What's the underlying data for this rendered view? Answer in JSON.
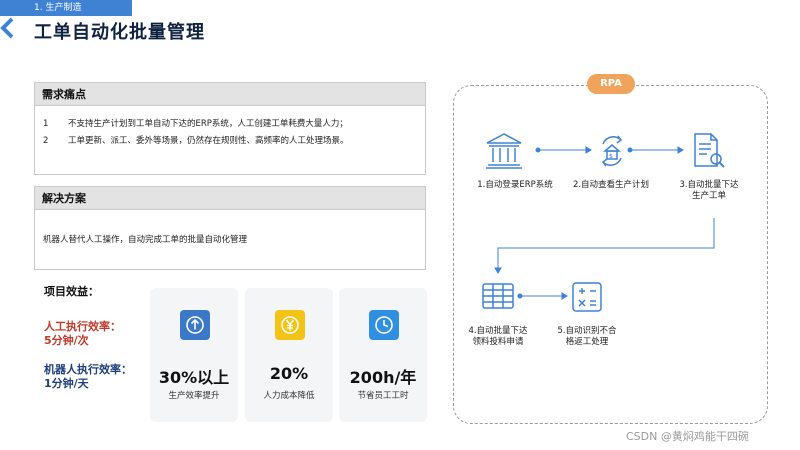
{
  "header": {
    "section_tag": "1. 生产制造",
    "title": "工单自动化批量管理"
  },
  "pain_points": {
    "title": "需求痛点",
    "items": [
      {
        "num": "1",
        "text": "不支持生产计划到工单自动下达的ERP系统，人工创建工单耗费大量人力；"
      },
      {
        "num": "2",
        "text": "工单更新、派工、委外等场景，仍然存在规则性、高频率的人工处理场景。"
      }
    ]
  },
  "solution": {
    "title": "解决方案",
    "text": "机器人替代人工操作，自动完成工单的批量自动化管理"
  },
  "benefits": {
    "title": "项目效益：",
    "human_line1": "人工执行效率：",
    "human_line2": "5分钟/次",
    "robot_line1": "机器人执行效率：",
    "robot_line2": "1分钟/天",
    "cards": [
      {
        "value": "30%以上",
        "caption": "生产效率提升",
        "icon": "arrow-up-icon",
        "color": "#3b78c7"
      },
      {
        "value": "20%",
        "caption": "人力成本降低",
        "icon": "yen-icon",
        "color": "#f3c315"
      },
      {
        "value": "200h/年",
        "caption": "节省员工工时",
        "icon": "clock-icon",
        "color": "#2f8fe0"
      }
    ]
  },
  "rpa": {
    "label": "RPA",
    "steps": [
      {
        "line1": "1.自动登录ERP系统",
        "line2": "",
        "icon": "bank-icon"
      },
      {
        "line1": "2.自动查看生产计划",
        "line2": "",
        "icon": "cycle-house-icon"
      },
      {
        "line1": "3.自动批量下达",
        "line2": "生产工单",
        "icon": "document-search-icon"
      },
      {
        "line1": "4.自动批量下达",
        "line2": "领料投料申请",
        "icon": "table-icon"
      },
      {
        "line1": "5.自动识别不合",
        "line2": "格返工处理",
        "icon": "calculator-icon"
      }
    ],
    "accent": "#3f82d3"
  },
  "watermark": "CSDN @黄焖鸡能干四碗"
}
